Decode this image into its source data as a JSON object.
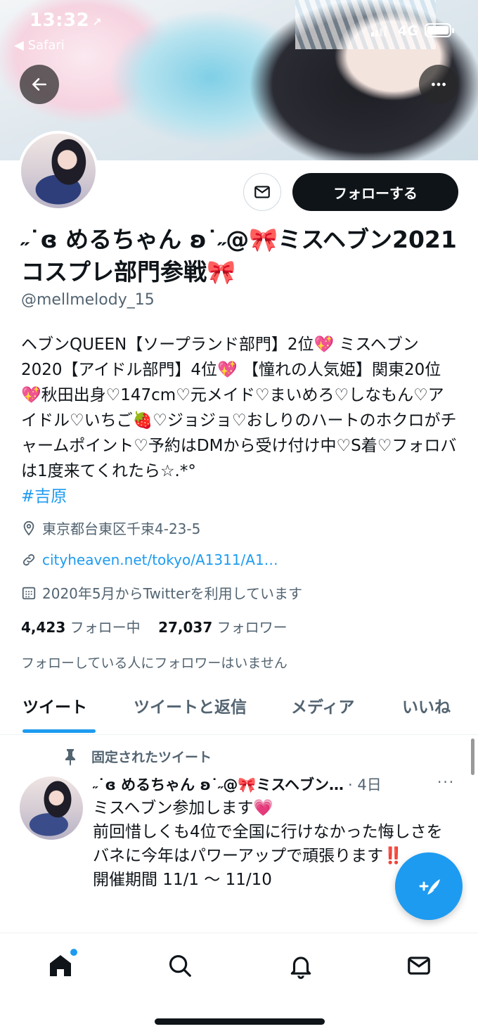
{
  "status_bar": {
    "time": "13:32",
    "time_arrow": "↗",
    "back_app": "◀ Safari",
    "network": "4G"
  },
  "header": {
    "back_icon": "arrow-left-icon",
    "more_icon": "more-horizontal-icon"
  },
  "profile": {
    "name": "˶˙ɞ めるちゃん ʚ˙˶@🎀ミスヘブン2021コスプレ部門参戦🎀",
    "handle": "@mellmelody_15",
    "follow_label": "フォローする",
    "bio": "ヘブンQUEEN【ソープランド部門】2位💖 ミスヘブン2020【アイドル部門】4位💖 【憧れの人気姫】関東20位💖秋田出身♡147cm♡元メイド♡まいめろ♡しなもん♡アイドル♡いちご🍓♡ジョジョ♡おしりのハートのホクロがチャームポイント♡予約はDMから受け付け中♡S着♡フォロバは1度来てくれたら☆.*°",
    "hashtag": "#吉原",
    "location": "東京都台東区千束4-23-5",
    "url": "cityheaven.net/tokyo/A1311/A1…",
    "joined": "2020年5月からTwitterを利用しています",
    "following_count": "4,423",
    "following_label": "フォロー中",
    "followers_count": "27,037",
    "followers_label": "フォロワー",
    "follow_note": "フォローしている人にフォロワーはいません"
  },
  "tabs": [
    {
      "label": "ツイート"
    },
    {
      "label": "ツイートと返信"
    },
    {
      "label": "メディア"
    },
    {
      "label": "いいね"
    }
  ],
  "pinned_tweet": {
    "pinned_label": "固定されたツイート",
    "author": "˶˙ɞ めるちゃん ʚ˙˶@🎀ミスヘブン…",
    "date": "· 4日",
    "more": "···",
    "lines": [
      "ミスヘブン参加します💗",
      "前回惜しくも4位で全国に行けなかった悔しさをバネに今年はパワーアップで頑張ります‼️",
      "",
      "開催期間 11/1 ～ 11/10"
    ]
  },
  "colors": {
    "accent": "#1d9bf0",
    "text": "#0f1419",
    "muted": "#536471"
  },
  "bottom_nav": [
    {
      "icon": "home-icon"
    },
    {
      "icon": "search-icon"
    },
    {
      "icon": "bell-icon"
    },
    {
      "icon": "mail-icon"
    }
  ]
}
